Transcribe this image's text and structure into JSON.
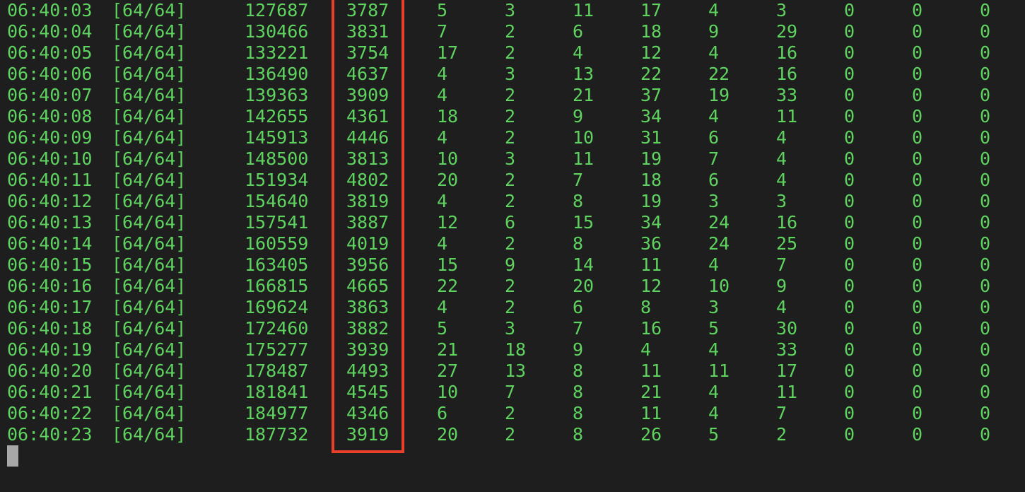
{
  "colors": {
    "background": "#1e1e1e",
    "text": "#5fd35f",
    "highlight": "#e8402a",
    "cursor": "#a8a8a8"
  },
  "rows": [
    [
      "06:40:03",
      "[64/64]",
      "127687",
      "3787",
      "5",
      "3",
      "11",
      "17",
      "4",
      "3",
      "0",
      "0",
      "0"
    ],
    [
      "06:40:04",
      "[64/64]",
      "130466",
      "3831",
      "7",
      "2",
      "6",
      "18",
      "9",
      "29",
      "0",
      "0",
      "0"
    ],
    [
      "06:40:05",
      "[64/64]",
      "133221",
      "3754",
      "17",
      "2",
      "4",
      "12",
      "4",
      "16",
      "0",
      "0",
      "0"
    ],
    [
      "06:40:06",
      "[64/64]",
      "136490",
      "4637",
      "4",
      "3",
      "13",
      "22",
      "22",
      "16",
      "0",
      "0",
      "0"
    ],
    [
      "06:40:07",
      "[64/64]",
      "139363",
      "3909",
      "4",
      "2",
      "21",
      "37",
      "19",
      "33",
      "0",
      "0",
      "0"
    ],
    [
      "06:40:08",
      "[64/64]",
      "142655",
      "4361",
      "18",
      "2",
      "9",
      "34",
      "4",
      "11",
      "0",
      "0",
      "0"
    ],
    [
      "06:40:09",
      "[64/64]",
      "145913",
      "4446",
      "4",
      "2",
      "10",
      "31",
      "6",
      "4",
      "0",
      "0",
      "0"
    ],
    [
      "06:40:10",
      "[64/64]",
      "148500",
      "3813",
      "10",
      "3",
      "11",
      "19",
      "7",
      "4",
      "0",
      "0",
      "0"
    ],
    [
      "06:40:11",
      "[64/64]",
      "151934",
      "4802",
      "20",
      "2",
      "7",
      "18",
      "6",
      "4",
      "0",
      "0",
      "0"
    ],
    [
      "06:40:12",
      "[64/64]",
      "154640",
      "3819",
      "4",
      "2",
      "8",
      "19",
      "3",
      "3",
      "0",
      "0",
      "0"
    ],
    [
      "06:40:13",
      "[64/64]",
      "157541",
      "3887",
      "12",
      "6",
      "15",
      "34",
      "24",
      "16",
      "0",
      "0",
      "0"
    ],
    [
      "06:40:14",
      "[64/64]",
      "160559",
      "4019",
      "4",
      "2",
      "8",
      "36",
      "24",
      "25",
      "0",
      "0",
      "0"
    ],
    [
      "06:40:15",
      "[64/64]",
      "163405",
      "3956",
      "15",
      "9",
      "14",
      "11",
      "4",
      "7",
      "0",
      "0",
      "0"
    ],
    [
      "06:40:16",
      "[64/64]",
      "166815",
      "4665",
      "22",
      "2",
      "20",
      "12",
      "10",
      "9",
      "0",
      "0",
      "0"
    ],
    [
      "06:40:17",
      "[64/64]",
      "169624",
      "3863",
      "4",
      "2",
      "6",
      "8",
      "3",
      "4",
      "0",
      "0",
      "0"
    ],
    [
      "06:40:18",
      "[64/64]",
      "172460",
      "3882",
      "5",
      "3",
      "7",
      "16",
      "5",
      "30",
      "0",
      "0",
      "0"
    ],
    [
      "06:40:19",
      "[64/64]",
      "175277",
      "3939",
      "21",
      "18",
      "9",
      "4",
      "4",
      "33",
      "0",
      "0",
      "0"
    ],
    [
      "06:40:20",
      "[64/64]",
      "178487",
      "4493",
      "27",
      "13",
      "8",
      "11",
      "11",
      "17",
      "0",
      "0",
      "0"
    ],
    [
      "06:40:21",
      "[64/64]",
      "181841",
      "4545",
      "10",
      "7",
      "8",
      "21",
      "4",
      "11",
      "0",
      "0",
      "0"
    ],
    [
      "06:40:22",
      "[64/64]",
      "184977",
      "4346",
      "6",
      "2",
      "8",
      "11",
      "4",
      "7",
      "0",
      "0",
      "0"
    ],
    [
      "06:40:23",
      "[64/64]",
      "187732",
      "3919",
      "20",
      "2",
      "8",
      "26",
      "5",
      "2",
      "0",
      "0",
      "0"
    ]
  ]
}
